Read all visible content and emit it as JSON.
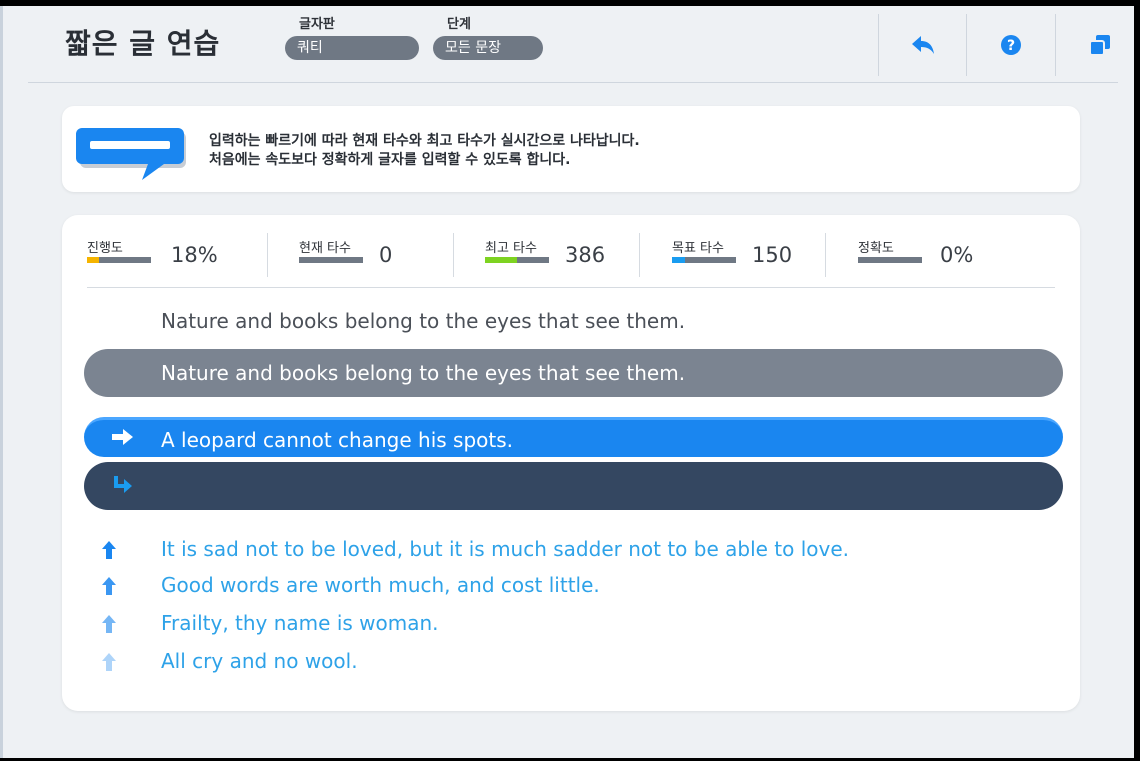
{
  "header": {
    "title": "짧은 글 연습",
    "keyboard_label": "글자판",
    "keyboard_value": "쿼티",
    "stage_label": "단계",
    "stage_value": "모든 문장",
    "back_icon": "back-arrow-icon",
    "help_icon": "help-icon",
    "window_icon": "window-icon"
  },
  "info": {
    "line1": "입력하는 빠르기에 따라 현재 타수와 최고 타수가 실시간으로 나타납니다.",
    "line2": "처음에는 속도보다 정확하게 글자를 입력할 수 있도록 합니다."
  },
  "stats": {
    "progress_label": "진행도",
    "progress_value": "18%",
    "progress_fraction": 0.18,
    "current_label": "현재 타수",
    "current_value": "0",
    "current_fraction": 0,
    "best_label": "최고 타수",
    "best_value": "386",
    "best_fraction": 0.5,
    "target_label": "목표 타수",
    "target_value": "150",
    "target_fraction": 0.2,
    "accuracy_label": "정확도",
    "accuracy_value": "0%",
    "accuracy_fraction": 0,
    "colors": {
      "progress": "#f5b400",
      "best": "#7ed321",
      "target": "#1a9cf0",
      "bar_bg": "#6f7884"
    }
  },
  "typing": {
    "previous_sentence": "Nature and books belong to the eyes that see them.",
    "previous_typed": "Nature and books belong to the eyes that see them.",
    "current_sentence": "A leopard cannot change his spots.",
    "input_value": ""
  },
  "upcoming": [
    "It is sad not to be loved, but it is much sadder not to be able to love.",
    "Good words are worth much, and cost little.",
    "Frailty, thy name is woman.",
    "All cry and no wool."
  ],
  "upcoming_arrow_opacity": [
    1,
    0.85,
    0.6,
    0.35
  ]
}
